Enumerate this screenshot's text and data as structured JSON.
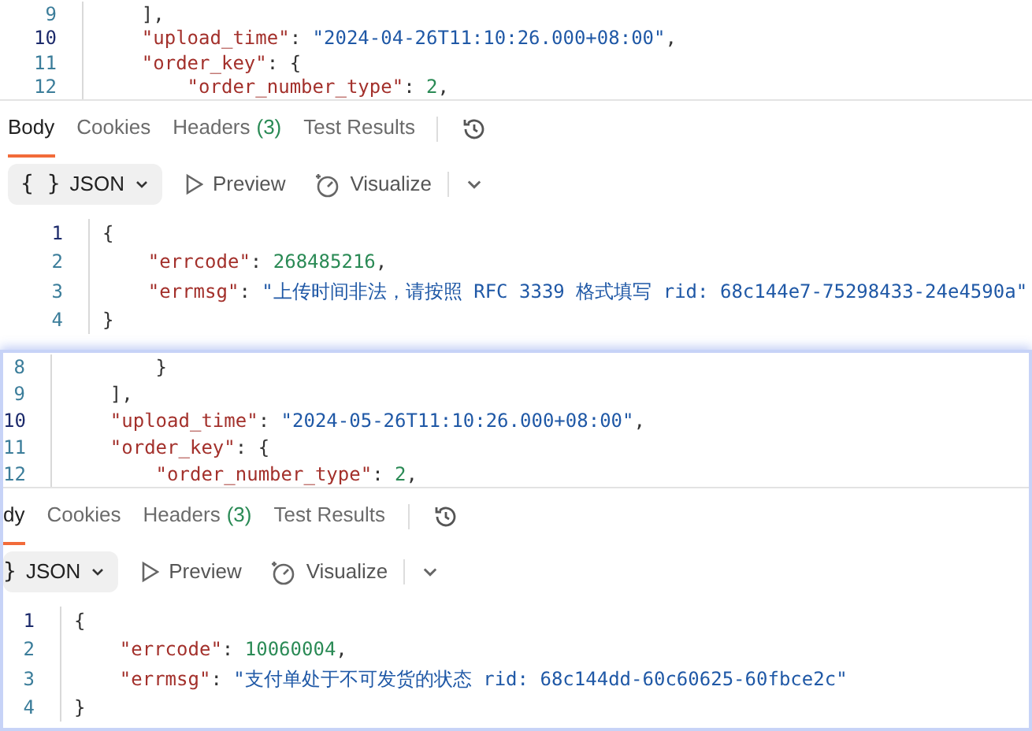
{
  "panels": [
    {
      "editor": {
        "lines": [
          {
            "number": "9",
            "current": false,
            "tokens": [
              {
                "kind": "punct",
                "text": "    ],"
              }
            ]
          },
          {
            "number": "10",
            "current": true,
            "tokens": [
              {
                "kind": "key",
                "text": "    \"upload_time\""
              },
              {
                "kind": "punct",
                "text": ": "
              },
              {
                "kind": "string",
                "text": "\"2024-04-26T11:10:26.000+08:00\""
              },
              {
                "kind": "punct",
                "text": ","
              }
            ]
          },
          {
            "number": "11",
            "current": false,
            "tokens": [
              {
                "kind": "key",
                "text": "    \"order_key\""
              },
              {
                "kind": "punct",
                "text": ": {"
              }
            ]
          },
          {
            "number": "12",
            "current": false,
            "tokens": [
              {
                "kind": "key",
                "text": "        \"order_number_type\""
              },
              {
                "kind": "punct",
                "text": ": "
              },
              {
                "kind": "number",
                "text": "2"
              },
              {
                "kind": "punct",
                "text": ","
              }
            ]
          }
        ]
      },
      "tabs": [
        {
          "label": "Body",
          "selected": true
        },
        {
          "label": "Cookies",
          "selected": false
        },
        {
          "label": "Headers",
          "count": "(3)",
          "selected": false
        },
        {
          "label": "Test Results",
          "selected": false
        }
      ],
      "toolbar": {
        "format_icon": "{ }",
        "format": "JSON",
        "preview": "Preview",
        "visualize": "Visualize"
      },
      "response": {
        "lines": [
          {
            "number": "1",
            "current": true,
            "tokens": [
              {
                "kind": "punct",
                "text": "{"
              }
            ]
          },
          {
            "number": "2",
            "current": false,
            "tokens": [
              {
                "kind": "key",
                "text": "    \"errcode\""
              },
              {
                "kind": "punct",
                "text": ": "
              },
              {
                "kind": "number",
                "text": "268485216"
              },
              {
                "kind": "punct",
                "text": ","
              }
            ]
          },
          {
            "number": "3",
            "current": false,
            "tokens": [
              {
                "kind": "key",
                "text": "    \"errmsg\""
              },
              {
                "kind": "punct",
                "text": ": "
              },
              {
                "kind": "string",
                "text": "\"上传时间非法，请按照 RFC 3339 格式填写 rid: 68c144e7-75298433-24e4590a\""
              }
            ]
          },
          {
            "number": "4",
            "current": false,
            "tokens": [
              {
                "kind": "punct",
                "text": "}"
              }
            ]
          }
        ]
      }
    },
    {
      "editor": {
        "lines": [
          {
            "number": "8",
            "current": false,
            "tokens": [
              {
                "kind": "punct",
                "text": "        }"
              }
            ]
          },
          {
            "number": "9",
            "current": false,
            "tokens": [
              {
                "kind": "punct",
                "text": "    ],"
              }
            ]
          },
          {
            "number": "10",
            "current": true,
            "tokens": [
              {
                "kind": "key",
                "text": "    \"upload_time\""
              },
              {
                "kind": "punct",
                "text": ": "
              },
              {
                "kind": "string",
                "text": "\"2024-05-26T11:10:26.000+08:00\""
              },
              {
                "kind": "punct",
                "text": ","
              }
            ]
          },
          {
            "number": "11",
            "current": false,
            "tokens": [
              {
                "kind": "key",
                "text": "    \"order_key\""
              },
              {
                "kind": "punct",
                "text": ": {"
              }
            ]
          },
          {
            "number": "12",
            "current": false,
            "tokens": [
              {
                "kind": "key",
                "text": "        \"order_number_type\""
              },
              {
                "kind": "punct",
                "text": ": "
              },
              {
                "kind": "number",
                "text": "2"
              },
              {
                "kind": "punct",
                "text": ","
              }
            ]
          }
        ]
      },
      "tabs": [
        {
          "label": "dy",
          "selected": true
        },
        {
          "label": "Cookies",
          "selected": false
        },
        {
          "label": "Headers",
          "count": "(3)",
          "selected": false
        },
        {
          "label": "Test Results",
          "selected": false
        }
      ],
      "toolbar": {
        "format_icon": "}",
        "format": "JSON",
        "preview": "Preview",
        "visualize": "Visualize"
      },
      "response": {
        "lines": [
          {
            "number": "1",
            "current": true,
            "tokens": [
              {
                "kind": "punct",
                "text": "{"
              }
            ]
          },
          {
            "number": "2",
            "current": false,
            "tokens": [
              {
                "kind": "key",
                "text": "    \"errcode\""
              },
              {
                "kind": "punct",
                "text": ": "
              },
              {
                "kind": "number",
                "text": "10060004"
              },
              {
                "kind": "punct",
                "text": ","
              }
            ]
          },
          {
            "number": "3",
            "current": false,
            "tokens": [
              {
                "kind": "key",
                "text": "    \"errmsg\""
              },
              {
                "kind": "punct",
                "text": ": "
              },
              {
                "kind": "string",
                "text": "\"支付单处于不可发货的状态 rid: 68c144dd-60c60625-60fbce2c\""
              }
            ]
          },
          {
            "number": "4",
            "current": false,
            "tokens": [
              {
                "kind": "punct",
                "text": "}"
              }
            ]
          }
        ]
      }
    }
  ]
}
